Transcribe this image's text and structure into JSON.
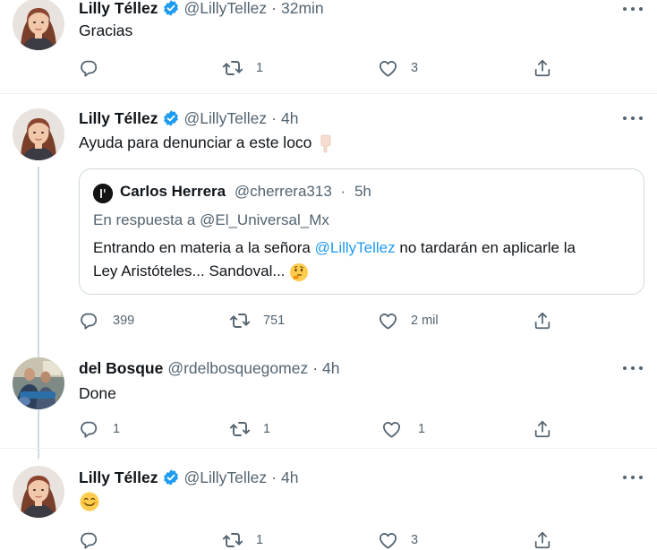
{
  "tweets": [
    {
      "name": "Lilly Téllez",
      "handle": "@LillyTellez",
      "dot": "·",
      "time": "32min",
      "text": "Gracias",
      "replies": "",
      "retweets": "1",
      "likes": "3"
    },
    {
      "name": "Lilly Téllez",
      "handle": "@LillyTellez",
      "dot": "·",
      "time": "4h",
      "text": "Ayuda para denunciar a este loco",
      "text_emoji": "pointing-down-hand-emoji",
      "replies": "399",
      "retweets": "751",
      "likes": "2 mil",
      "quote": {
        "name": "Carlos Herrera",
        "handle": "@cherrera313",
        "dot": "·",
        "time": "5h",
        "reply_prefix": "En respuesta a",
        "reply_to": "@El_Universal_Mx",
        "body_1": "Entrando en materia a la señora",
        "body_mention": "@LillyTellez",
        "body_2": "no tardarán en aplicarle la",
        "body_3": "Ley Aristóteles... Sandoval...",
        "body_emoji": "thinking-face-emoji"
      }
    },
    {
      "name": "del Bosque",
      "handle": "@rdelbosquegomez",
      "dot": "·",
      "time": "4h",
      "text": "Done",
      "replies": "1",
      "retweets": "1",
      "likes": "1"
    },
    {
      "name": "Lilly Téllez",
      "handle": "@LillyTellez",
      "dot": "·",
      "time": "4h",
      "text_emoji": "smiling-face-emoji",
      "replies": "",
      "retweets": "1",
      "likes": "3"
    }
  ],
  "icons": {
    "reply": "reply-icon",
    "retweet": "retweet-icon",
    "like": "heart-icon",
    "share": "share-icon",
    "more": "more-icon",
    "verified": "verified-badge-icon"
  },
  "colors": {
    "text": "#0f1419",
    "secondary": "#536471",
    "accent": "#1d9bf0",
    "border": "#cfd9de",
    "thread_line": "#cfd9de"
  }
}
